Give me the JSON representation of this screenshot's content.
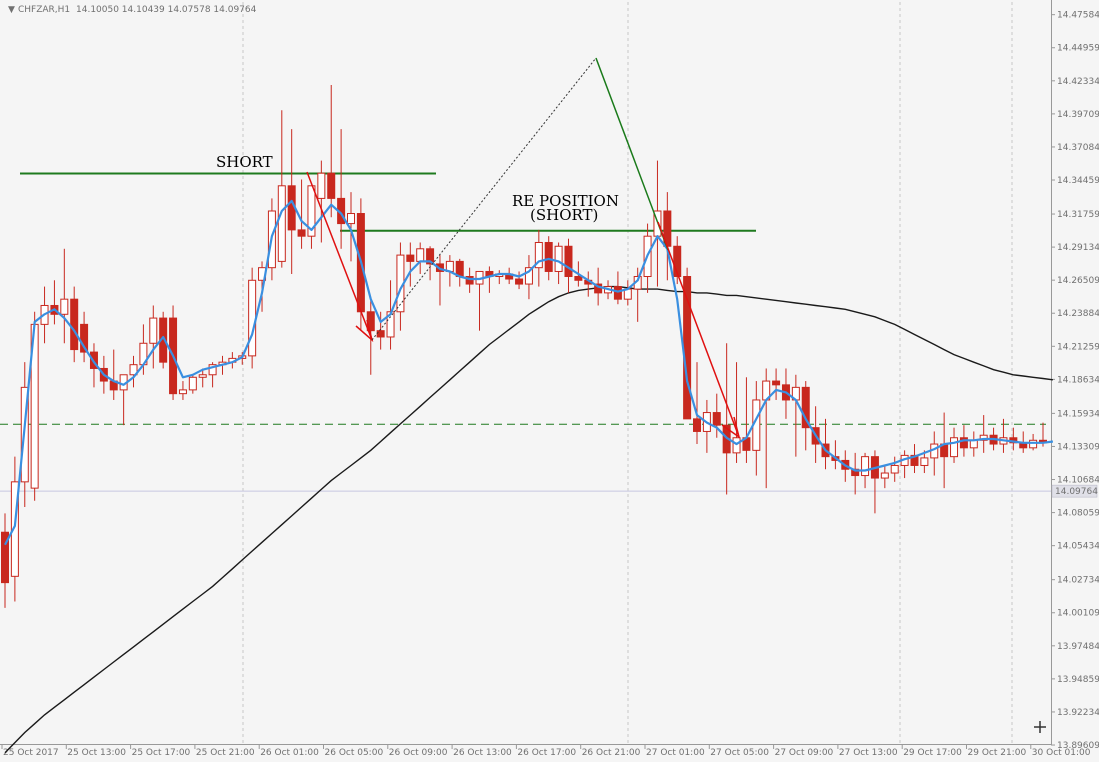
{
  "header": {
    "arrow": "▼",
    "symbol": "CHFZAR,H1",
    "ohlc": "14.10050 14.10439 14.07578 14.09764"
  },
  "current_price_label": "14.09764",
  "annotations": {
    "short_label": "SHORT",
    "reposition_line1": "RE POSITION",
    "reposition_line2": "(SHORT)"
  },
  "colors": {
    "background": "#f5f5f5",
    "candle": "#c8281e",
    "ma_fast": "#3a8fe0",
    "ma_slow": "#1a1a1a",
    "level_line": "#1e7a1e",
    "arrow_red": "#e01010",
    "arrow_green": "#1a7a1a",
    "grid": "#c8c8c8"
  },
  "icons": {
    "crosshair": "crosshair-icon"
  },
  "chart_data": {
    "type": "candlestick",
    "ylim": [
      13.8969,
      14.4859
    ],
    "y_ticks": [
      "14.47584",
      "14.44959",
      "14.42334",
      "14.39709",
      "14.37084",
      "14.34459",
      "14.31759",
      "14.29134",
      "14.26509",
      "14.23884",
      "14.21259",
      "14.18634",
      "14.15934",
      "14.13309",
      "14.10684",
      "14.08059",
      "14.05434",
      "14.02734",
      "14.00109",
      "13.97484",
      "13.94859",
      "13.92234",
      "13.89609"
    ],
    "x_ticks": [
      "25 Oct 2017",
      "25 Oct 13:00",
      "25 Oct 17:00",
      "25 Oct 21:00",
      "26 Oct 01:00",
      "26 Oct 05:00",
      "26 Oct 09:00",
      "26 Oct 13:00",
      "26 Oct 17:00",
      "26 Oct 21:00",
      "27 Oct 01:00",
      "27 Oct 05:00",
      "27 Oct 09:00",
      "27 Oct 13:00",
      "29 Oct 17:00",
      "29 Oct 21:00",
      "30 Oct 01:00"
    ],
    "current_price": 14.09764,
    "level_dashed": 14.1507,
    "level_short": 14.3498,
    "level_reposition": 14.3043,
    "candles": [
      {
        "o": 14.065,
        "h": 14.08,
        "l": 14.005,
        "c": 14.025
      },
      {
        "o": 14.03,
        "h": 14.125,
        "l": 14.01,
        "c": 14.105
      },
      {
        "o": 14.105,
        "h": 14.2,
        "l": 14.085,
        "c": 14.18
      },
      {
        "o": 14.1,
        "h": 14.24,
        "l": 14.09,
        "c": 14.23
      },
      {
        "o": 14.23,
        "h": 14.26,
        "l": 14.215,
        "c": 14.245
      },
      {
        "o": 14.245,
        "h": 14.265,
        "l": 14.23,
        "c": 14.238
      },
      {
        "o": 14.238,
        "h": 14.29,
        "l": 14.215,
        "c": 14.25
      },
      {
        "o": 14.25,
        "h": 14.26,
        "l": 14.2,
        "c": 14.21
      },
      {
        "o": 14.23,
        "h": 14.24,
        "l": 14.2,
        "c": 14.208
      },
      {
        "o": 14.208,
        "h": 14.215,
        "l": 14.18,
        "c": 14.195
      },
      {
        "o": 14.195,
        "h": 14.205,
        "l": 14.175,
        "c": 14.185
      },
      {
        "o": 14.185,
        "h": 14.21,
        "l": 14.17,
        "c": 14.178
      },
      {
        "o": 14.178,
        "h": 14.19,
        "l": 14.15,
        "c": 14.19
      },
      {
        "o": 14.19,
        "h": 14.205,
        "l": 14.18,
        "c": 14.198
      },
      {
        "o": 14.198,
        "h": 14.23,
        "l": 14.19,
        "c": 14.215
      },
      {
        "o": 14.215,
        "h": 14.245,
        "l": 14.195,
        "c": 14.235
      },
      {
        "o": 14.235,
        "h": 14.24,
        "l": 14.195,
        "c": 14.2
      },
      {
        "o": 14.235,
        "h": 14.245,
        "l": 14.17,
        "c": 14.175
      },
      {
        "o": 14.175,
        "h": 14.185,
        "l": 14.17,
        "c": 14.178
      },
      {
        "o": 14.178,
        "h": 14.19,
        "l": 14.175,
        "c": 14.188
      },
      {
        "o": 14.188,
        "h": 14.195,
        "l": 14.18,
        "c": 14.19
      },
      {
        "o": 14.19,
        "h": 14.2,
        "l": 14.18,
        "c": 14.198
      },
      {
        "o": 14.198,
        "h": 14.205,
        "l": 14.19,
        "c": 14.2
      },
      {
        "o": 14.2,
        "h": 14.208,
        "l": 14.195,
        "c": 14.203
      },
      {
        "o": 14.203,
        "h": 14.208,
        "l": 14.198,
        "c": 14.205
      },
      {
        "o": 14.205,
        "h": 14.275,
        "l": 14.195,
        "c": 14.265
      },
      {
        "o": 14.265,
        "h": 14.28,
        "l": 14.24,
        "c": 14.275
      },
      {
        "o": 14.275,
        "h": 14.33,
        "l": 14.265,
        "c": 14.32
      },
      {
        "o": 14.28,
        "h": 14.4,
        "l": 14.275,
        "c": 14.34
      },
      {
        "o": 14.34,
        "h": 14.385,
        "l": 14.27,
        "c": 14.305
      },
      {
        "o": 14.305,
        "h": 14.345,
        "l": 14.29,
        "c": 14.3
      },
      {
        "o": 14.3,
        "h": 14.33,
        "l": 14.29,
        "c": 14.34
      },
      {
        "o": 14.33,
        "h": 14.36,
        "l": 14.295,
        "c": 14.35
      },
      {
        "o": 14.35,
        "h": 14.42,
        "l": 14.315,
        "c": 14.33
      },
      {
        "o": 14.33,
        "h": 14.385,
        "l": 14.29,
        "c": 14.31
      },
      {
        "o": 14.31,
        "h": 14.335,
        "l": 14.28,
        "c": 14.318
      },
      {
        "o": 14.318,
        "h": 14.33,
        "l": 14.225,
        "c": 14.24
      },
      {
        "o": 14.24,
        "h": 14.25,
        "l": 14.19,
        "c": 14.225
      },
      {
        "o": 14.225,
        "h": 14.24,
        "l": 14.21,
        "c": 14.22
      },
      {
        "o": 14.22,
        "h": 14.265,
        "l": 14.21,
        "c": 14.24
      },
      {
        "o": 14.24,
        "h": 14.295,
        "l": 14.225,
        "c": 14.285
      },
      {
        "o": 14.285,
        "h": 14.295,
        "l": 14.26,
        "c": 14.28
      },
      {
        "o": 14.28,
        "h": 14.295,
        "l": 14.27,
        "c": 14.29
      },
      {
        "o": 14.29,
        "h": 14.292,
        "l": 14.265,
        "c": 14.278
      },
      {
        "o": 14.278,
        "h": 14.285,
        "l": 14.245,
        "c": 14.272
      },
      {
        "o": 14.272,
        "h": 14.285,
        "l": 14.26,
        "c": 14.28
      },
      {
        "o": 14.28,
        "h": 14.282,
        "l": 14.26,
        "c": 14.268
      },
      {
        "o": 14.268,
        "h": 14.275,
        "l": 14.255,
        "c": 14.262
      },
      {
        "o": 14.262,
        "h": 14.27,
        "l": 14.225,
        "c": 14.272
      },
      {
        "o": 14.272,
        "h": 14.276,
        "l": 14.255,
        "c": 14.268
      },
      {
        "o": 14.268,
        "h": 14.273,
        "l": 14.262,
        "c": 14.27
      },
      {
        "o": 14.27,
        "h": 14.275,
        "l": 14.262,
        "c": 14.266
      },
      {
        "o": 14.266,
        "h": 14.272,
        "l": 14.258,
        "c": 14.262
      },
      {
        "o": 14.262,
        "h": 14.285,
        "l": 14.25,
        "c": 14.275
      },
      {
        "o": 14.275,
        "h": 14.305,
        "l": 14.26,
        "c": 14.295
      },
      {
        "o": 14.295,
        "h": 14.3,
        "l": 14.265,
        "c": 14.272
      },
      {
        "o": 14.272,
        "h": 14.295,
        "l": 14.262,
        "c": 14.292
      },
      {
        "o": 14.292,
        "h": 14.298,
        "l": 14.255,
        "c": 14.268
      },
      {
        "o": 14.268,
        "h": 14.28,
        "l": 14.26,
        "c": 14.265
      },
      {
        "o": 14.265,
        "h": 14.272,
        "l": 14.252,
        "c": 14.262
      },
      {
        "o": 14.262,
        "h": 14.275,
        "l": 14.245,
        "c": 14.255
      },
      {
        "o": 14.255,
        "h": 14.265,
        "l": 14.25,
        "c": 14.26
      },
      {
        "o": 14.26,
        "h": 14.272,
        "l": 14.246,
        "c": 14.25
      },
      {
        "o": 14.25,
        "h": 14.265,
        "l": 14.245,
        "c": 14.258
      },
      {
        "o": 14.258,
        "h": 14.275,
        "l": 14.232,
        "c": 14.268
      },
      {
        "o": 14.268,
        "h": 14.31,
        "l": 14.255,
        "c": 14.3
      },
      {
        "o": 14.3,
        "h": 14.36,
        "l": 14.26,
        "c": 14.32
      },
      {
        "o": 14.32,
        "h": 14.335,
        "l": 14.265,
        "c": 14.292
      },
      {
        "o": 14.292,
        "h": 14.3,
        "l": 14.262,
        "c": 14.268
      },
      {
        "o": 14.268,
        "h": 14.275,
        "l": 14.19,
        "c": 14.155
      },
      {
        "o": 14.155,
        "h": 14.2,
        "l": 14.135,
        "c": 14.145
      },
      {
        "o": 14.145,
        "h": 14.17,
        "l": 14.128,
        "c": 14.16
      },
      {
        "o": 14.16,
        "h": 14.175,
        "l": 14.14,
        "c": 14.15
      },
      {
        "o": 14.15,
        "h": 14.215,
        "l": 14.095,
        "c": 14.128
      },
      {
        "o": 14.128,
        "h": 14.2,
        "l": 14.12,
        "c": 14.14
      },
      {
        "o": 14.14,
        "h": 14.188,
        "l": 14.12,
        "c": 14.13
      },
      {
        "o": 14.13,
        "h": 14.185,
        "l": 14.11,
        "c": 14.17
      },
      {
        "o": 14.17,
        "h": 14.195,
        "l": 14.1,
        "c": 14.185
      },
      {
        "o": 14.185,
        "h": 14.195,
        "l": 14.17,
        "c": 14.182
      },
      {
        "o": 14.182,
        "h": 14.195,
        "l": 14.155,
        "c": 14.17
      },
      {
        "o": 14.17,
        "h": 14.19,
        "l": 14.125,
        "c": 14.18
      },
      {
        "o": 14.18,
        "h": 14.185,
        "l": 14.13,
        "c": 14.148
      },
      {
        "o": 14.148,
        "h": 14.165,
        "l": 14.12,
        "c": 14.135
      },
      {
        "o": 14.135,
        "h": 14.155,
        "l": 14.115,
        "c": 14.125
      },
      {
        "o": 14.125,
        "h": 14.138,
        "l": 14.115,
        "c": 14.122
      },
      {
        "o": 14.122,
        "h": 14.13,
        "l": 14.105,
        "c": 14.115
      },
      {
        "o": 14.115,
        "h": 14.128,
        "l": 14.095,
        "c": 14.11
      },
      {
        "o": 14.11,
        "h": 14.128,
        "l": 14.1,
        "c": 14.125
      },
      {
        "o": 14.125,
        "h": 14.13,
        "l": 14.08,
        "c": 14.108
      },
      {
        "o": 14.108,
        "h": 14.118,
        "l": 14.1,
        "c": 14.112
      },
      {
        "o": 14.112,
        "h": 14.125,
        "l": 14.105,
        "c": 14.118
      },
      {
        "o": 14.118,
        "h": 14.13,
        "l": 14.108,
        "c": 14.126
      },
      {
        "o": 14.126,
        "h": 14.135,
        "l": 14.112,
        "c": 14.118
      },
      {
        "o": 14.118,
        "h": 14.13,
        "l": 14.112,
        "c": 14.124
      },
      {
        "o": 14.124,
        "h": 14.145,
        "l": 14.11,
        "c": 14.135
      },
      {
        "o": 14.135,
        "h": 14.16,
        "l": 14.1,
        "c": 14.125
      },
      {
        "o": 14.125,
        "h": 14.148,
        "l": 14.12,
        "c": 14.14
      },
      {
        "o": 14.14,
        "h": 14.15,
        "l": 14.125,
        "c": 14.132
      },
      {
        "o": 14.132,
        "h": 14.145,
        "l": 14.125,
        "c": 14.138
      },
      {
        "o": 14.138,
        "h": 14.158,
        "l": 14.128,
        "c": 14.142
      },
      {
        "o": 14.142,
        "h": 14.148,
        "l": 14.13,
        "c": 14.135
      },
      {
        "o": 14.135,
        "h": 14.155,
        "l": 14.128,
        "c": 14.14
      },
      {
        "o": 14.14,
        "h": 14.148,
        "l": 14.13,
        "c": 14.136
      },
      {
        "o": 14.136,
        "h": 14.145,
        "l": 14.128,
        "c": 14.132
      },
      {
        "o": 14.132,
        "h": 14.143,
        "l": 14.13,
        "c": 14.138
      },
      {
        "o": 14.138,
        "h": 14.152,
        "l": 14.133,
        "c": 14.136
      }
    ],
    "ma_fast": [
      14.055,
      14.07,
      14.15,
      14.232,
      14.238,
      14.242,
      14.235,
      14.225,
      14.212,
      14.2,
      14.19,
      14.185,
      14.182,
      14.188,
      14.198,
      14.21,
      14.22,
      14.205,
      14.188,
      14.19,
      14.194,
      14.196,
      14.198,
      14.2,
      14.204,
      14.222,
      14.255,
      14.3,
      14.32,
      14.328,
      14.312,
      14.305,
      14.315,
      14.325,
      14.318,
      14.305,
      14.28,
      14.25,
      14.232,
      14.238,
      14.258,
      14.272,
      14.28,
      14.28,
      14.274,
      14.272,
      14.268,
      14.266,
      14.266,
      14.268,
      14.27,
      14.27,
      14.268,
      14.272,
      14.28,
      14.282,
      14.28,
      14.275,
      14.27,
      14.265,
      14.26,
      14.258,
      14.256,
      14.258,
      14.265,
      14.285,
      14.3,
      14.29,
      14.25,
      14.185,
      14.158,
      14.152,
      14.148,
      14.14,
      14.135,
      14.14,
      14.155,
      14.17,
      14.178,
      14.176,
      14.17,
      14.155,
      14.142,
      14.13,
      14.124,
      14.118,
      14.114,
      14.114,
      14.116,
      14.118,
      14.12,
      14.123,
      14.125,
      14.128,
      14.131,
      14.135,
      14.136,
      14.138,
      14.138,
      14.139,
      14.139,
      14.138,
      14.137,
      14.136,
      14.136,
      14.136,
      14.137
    ],
    "ma_slow": [
      13.89,
      13.898,
      13.906,
      13.913,
      13.92,
      13.926,
      13.932,
      13.938,
      13.944,
      13.95,
      13.956,
      13.962,
      13.968,
      13.974,
      13.98,
      13.986,
      13.992,
      13.998,
      14.004,
      14.01,
      14.016,
      14.022,
      14.029,
      14.036,
      14.043,
      14.05,
      14.057,
      14.064,
      14.071,
      14.078,
      14.085,
      14.092,
      14.099,
      14.106,
      14.112,
      14.118,
      14.124,
      14.13,
      14.137,
      14.144,
      14.151,
      14.158,
      14.165,
      14.172,
      14.179,
      14.186,
      14.193,
      14.2,
      14.207,
      14.214,
      14.22,
      14.226,
      14.232,
      14.238,
      14.243,
      14.248,
      14.252,
      14.255,
      14.257,
      14.258,
      14.259,
      14.26,
      14.26,
      14.259,
      14.258,
      14.258,
      14.258,
      14.257,
      14.256,
      14.256,
      14.255,
      14.255,
      14.254,
      14.253,
      14.253,
      14.252,
      14.251,
      14.25,
      14.249,
      14.248,
      14.247,
      14.246,
      14.245,
      14.244,
      14.243,
      14.242,
      14.24,
      14.238,
      14.236,
      14.233,
      14.23,
      14.226,
      14.222,
      14.218,
      14.214,
      14.21,
      14.206,
      14.203,
      14.2,
      14.197,
      14.194,
      14.192,
      14.19,
      14.189,
      14.188,
      14.187,
      14.186
    ]
  }
}
